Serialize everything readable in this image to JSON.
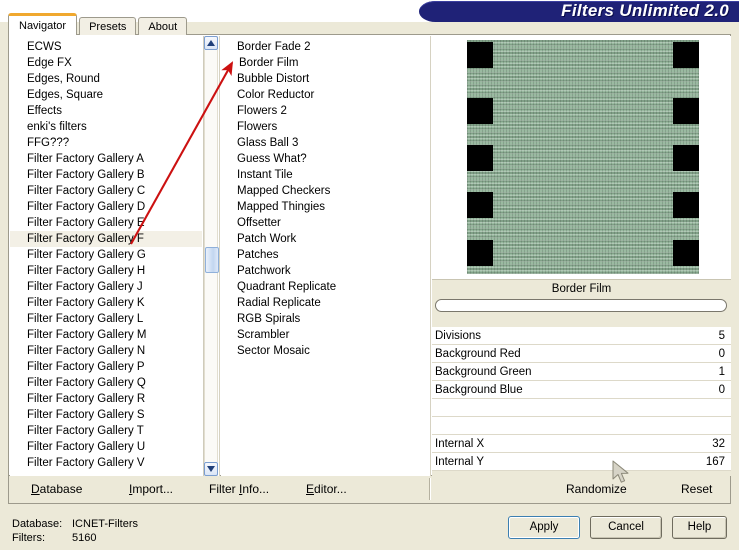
{
  "window": {
    "banner_title": "Filters Unlimited 2.0"
  },
  "tabs": [
    {
      "label": "Navigator",
      "active": true
    },
    {
      "label": "Presets",
      "active": false
    },
    {
      "label": "About",
      "active": false
    }
  ],
  "categories": {
    "selected": "Filter Factory Gallery F",
    "items": [
      "ECWS",
      "Edge FX",
      "Edges, Round",
      "Edges, Square",
      "Effects",
      "enki's filters",
      "FFG???",
      "Filter Factory Gallery A",
      "Filter Factory Gallery B",
      "Filter Factory Gallery C",
      "Filter Factory Gallery D",
      "Filter Factory Gallery E",
      "Filter Factory Gallery F",
      "Filter Factory Gallery G",
      "Filter Factory Gallery H",
      "Filter Factory Gallery J",
      "Filter Factory Gallery K",
      "Filter Factory Gallery L",
      "Filter Factory Gallery M",
      "Filter Factory Gallery N",
      "Filter Factory Gallery P",
      "Filter Factory Gallery Q",
      "Filter Factory Gallery R",
      "Filter Factory Gallery S",
      "Filter Factory Gallery T",
      "Filter Factory Gallery U",
      "Filter Factory Gallery V"
    ]
  },
  "filters": {
    "selected": "Border Film",
    "items": [
      "Border Fade 2",
      "Border Film",
      "Bubble Distort",
      "Color Reductor",
      "Flowers 2",
      "Flowers",
      "Glass Ball 3",
      "Guess What?",
      "Instant Tile",
      "Mapped Checkers",
      "Mapped Thingies",
      "Offsetter",
      "Patch Work",
      "Patches",
      "Patchwork",
      "Quadrant Replicate",
      "Radial Replicate",
      "RGB Spirals",
      "Scrambler",
      "Sector Mosaic"
    ]
  },
  "preview": {
    "title": "Border Film",
    "background_color": "#8fb296",
    "sprocket_color": "#000000",
    "sprockets_per_side": 5
  },
  "parameters": [
    {
      "name": "Divisions",
      "value": "5"
    },
    {
      "name": "Background Red",
      "value": "0"
    },
    {
      "name": "Background Green",
      "value": "1"
    },
    {
      "name": "Background Blue",
      "value": "0"
    },
    {
      "name": "",
      "value": ""
    },
    {
      "name": "",
      "value": ""
    },
    {
      "name": "Internal X",
      "value": "32"
    },
    {
      "name": "Internal Y",
      "value": "167"
    }
  ],
  "toolbar": {
    "database": "Database",
    "database_accel": "D",
    "import": "Import...",
    "import_accel": "I",
    "filter_info": "Filter Info...",
    "editor": "Editor...",
    "editor_accel": "E",
    "randomize": "Randomize",
    "reset": "Reset"
  },
  "status": {
    "database_label": "Database:",
    "database_value": "ICNET-Filters",
    "filters_label": "Filters:",
    "filters_value": "5160"
  },
  "dialog_buttons": {
    "apply": "Apply",
    "cancel": "Cancel",
    "help": "Help"
  },
  "annotation": {
    "color": "#cc1111",
    "type": "arrow",
    "points_to": "Border Film"
  }
}
